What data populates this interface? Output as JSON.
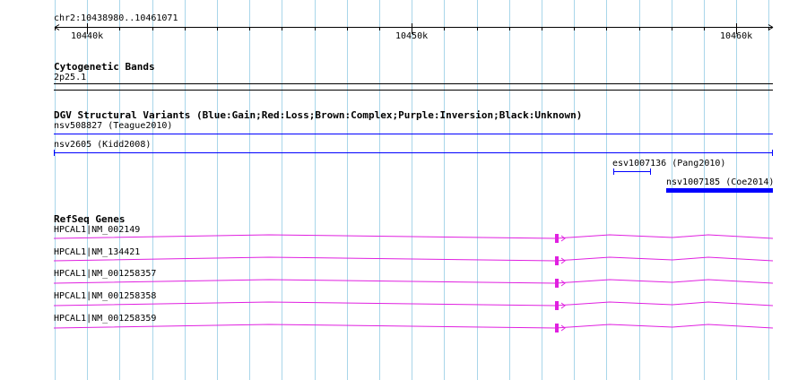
{
  "ruler": {
    "locus": "chr2:10438980..10461071",
    "ticks": [
      "10440k",
      "10450k",
      "10460k"
    ]
  },
  "cytoband": {
    "title": "Cytogenetic Bands",
    "band": "2p25.1"
  },
  "dgv": {
    "title": "DGV Structural Variants (Blue:Gain;Red:Loss;Brown:Complex;Purple:Inversion;Black:Unknown)",
    "variants": [
      {
        "label": "nsv508827 (Teague2010)",
        "color": "#0000ff"
      },
      {
        "label": "nsv2605 (Kidd2008)",
        "color": "#0000ff"
      },
      {
        "label": "esv1007136 (Pang2010)",
        "color": "#0000ff"
      },
      {
        "label": "nsv1007185 (Coe2014)",
        "color": "#0000ff"
      }
    ]
  },
  "refseq": {
    "title": "RefSeq Genes",
    "color": "#e020e0",
    "genes": [
      {
        "label": "HPCAL1|NM_002149"
      },
      {
        "label": "HPCAL1|NM_134421"
      },
      {
        "label": "HPCAL1|NM_001258357"
      },
      {
        "label": "HPCAL1|NM_001258358"
      },
      {
        "label": "HPCAL1|NM_001258359"
      }
    ]
  },
  "colors": {
    "grid": "#a9d6ea",
    "gain": "#0000ff",
    "gene": "#e020e0"
  }
}
